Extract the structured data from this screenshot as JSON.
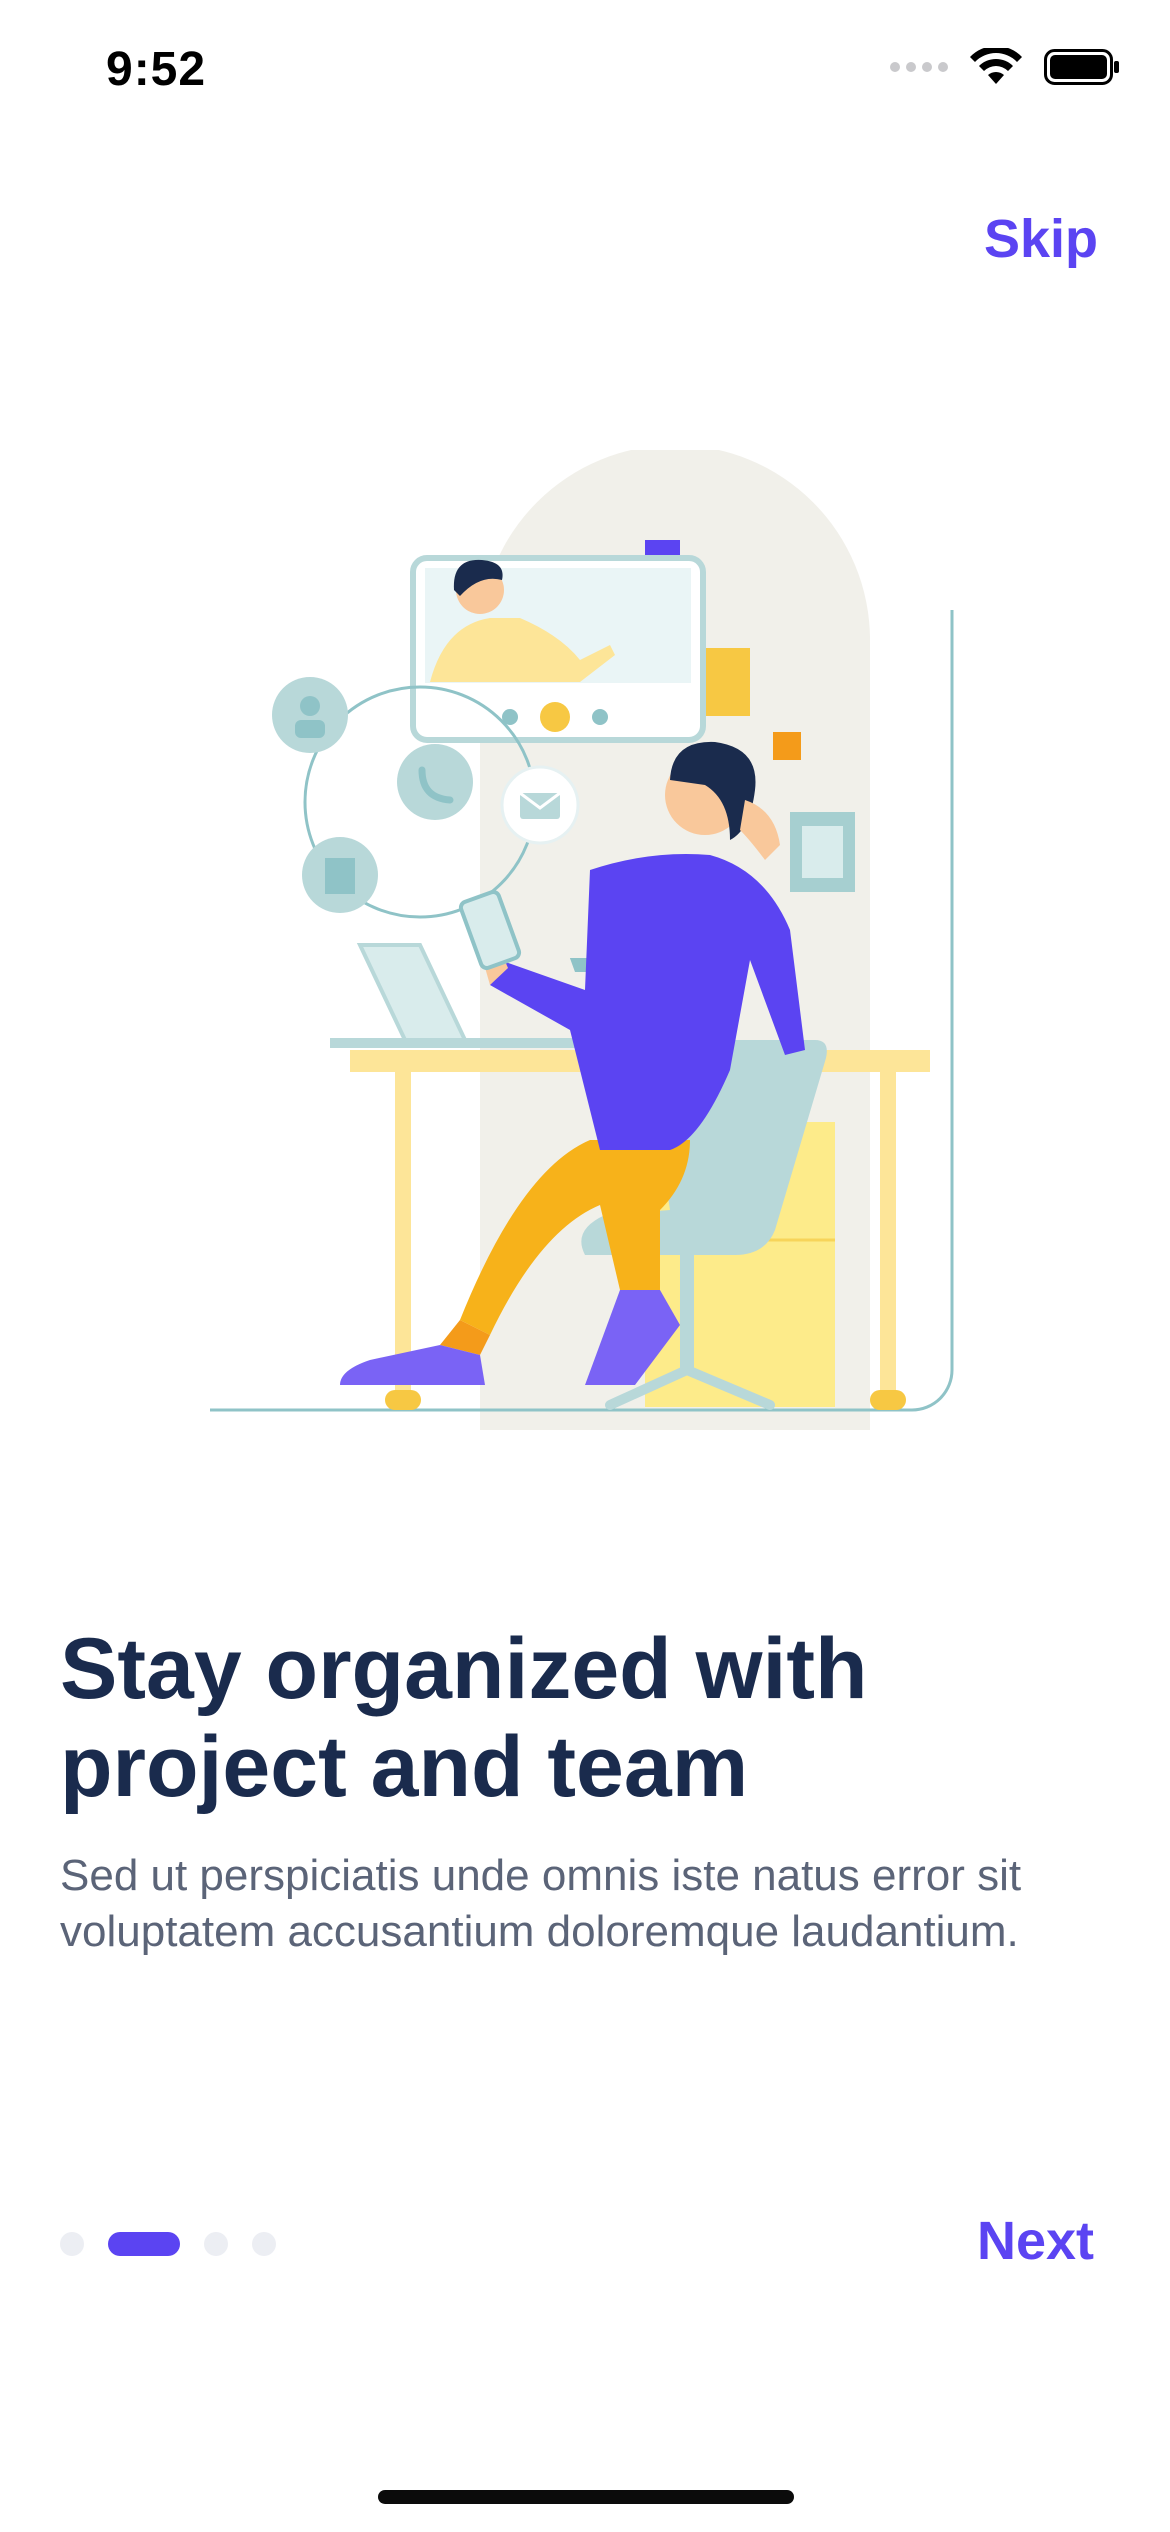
{
  "status_bar": {
    "time": "9:52"
  },
  "header": {
    "skip_label": "Skip"
  },
  "illustration": {
    "name": "person-at-desk-video-call"
  },
  "content": {
    "headline": "Stay organized with project and team",
    "body": "Sed ut perspiciatis unde omnis iste natus error sit voluptatem accusantium doloremque laudantium."
  },
  "pager": {
    "pages": 4,
    "current_page": 2
  },
  "footer": {
    "next_label": "Next"
  },
  "colors": {
    "accent": "#5b44f2",
    "headline": "#1a2b4d",
    "body": "#5b6478",
    "inactive_dot": "#eceef3"
  }
}
